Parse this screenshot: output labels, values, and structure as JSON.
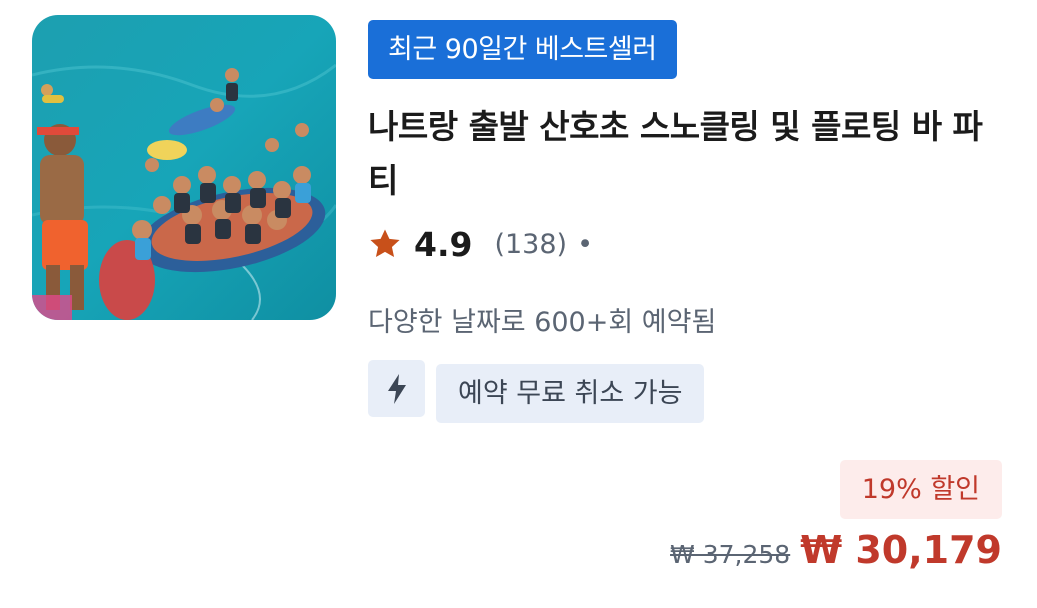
{
  "product": {
    "badge": "최근 90일간 베스트셀러",
    "title": "나트랑 출발 산호초 스노클링 및 플로팅 바 파티",
    "rating": {
      "icon": "star-icon",
      "value": "4.9",
      "count": "(138)",
      "separator": "•"
    },
    "booked_text": "다양한 날짜로 600+회 예약됨",
    "features": {
      "icon": "lightning-icon",
      "cancellation": "예약 무료 취소 가능"
    },
    "pricing": {
      "discount": "19% 할인",
      "original_price": "₩ 37,258",
      "price": "₩ 30,179"
    }
  },
  "colors": {
    "badge_bg": "#1a6fd8",
    "star": "#c8501a",
    "discount_text": "#c0392b",
    "discount_bg": "#fdeceb",
    "tag_bg": "#e8eef8"
  }
}
